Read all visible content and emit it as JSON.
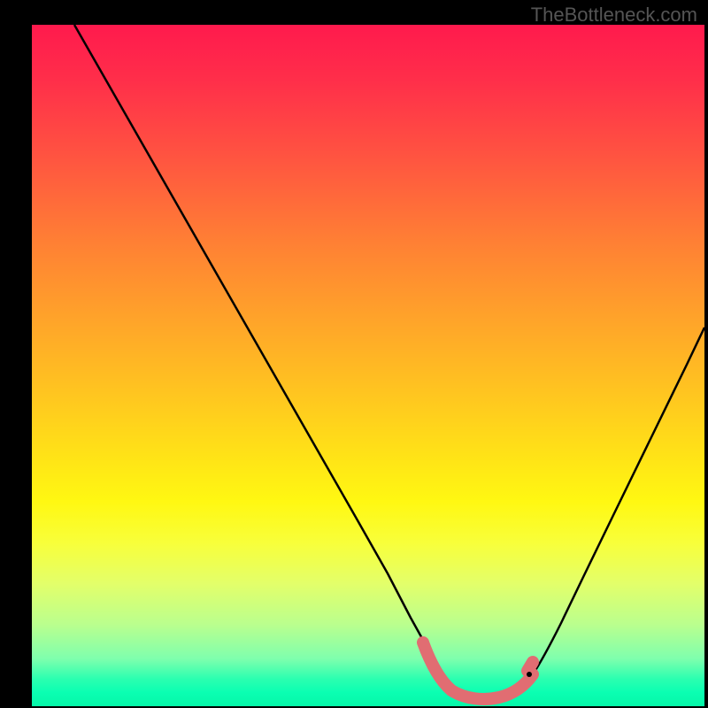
{
  "watermark": "TheBottleneck.com",
  "chart_data": {
    "type": "line",
    "title": "",
    "xlabel": "",
    "ylabel": "",
    "xlim": [
      0,
      100
    ],
    "ylim": [
      0,
      100
    ],
    "series": [
      {
        "name": "bottleneck-curve",
        "x": [
          0,
          5,
          10,
          15,
          20,
          25,
          30,
          35,
          40,
          45,
          50,
          55,
          57,
          59,
          61,
          63,
          65,
          67,
          69,
          71,
          73,
          76,
          80,
          85,
          90,
          95,
          100
        ],
        "y": [
          100,
          92,
          84,
          76,
          68,
          60,
          52,
          44,
          36,
          28,
          20,
          12,
          8,
          5,
          3,
          2,
          1.5,
          1.5,
          2,
          3,
          5,
          9,
          16,
          26,
          37,
          49,
          62
        ]
      }
    ],
    "highlight": {
      "name": "optimal-zone",
      "x": [
        57,
        58,
        59,
        60,
        61,
        62,
        63,
        64,
        65,
        66,
        67,
        68,
        69,
        70,
        71,
        72,
        73
      ],
      "y": [
        8,
        6,
        5,
        4,
        3,
        2.5,
        2,
        1.8,
        1.5,
        1.5,
        1.5,
        2,
        2,
        3,
        3,
        4,
        5
      ]
    },
    "background_gradient": {
      "stops": [
        {
          "pos": 0,
          "color": "#ff1a4d"
        },
        {
          "pos": 20,
          "color": "#ff5640"
        },
        {
          "pos": 44,
          "color": "#ffa629"
        },
        {
          "pos": 64,
          "color": "#ffe516"
        },
        {
          "pos": 82,
          "color": "#e3ff6a"
        },
        {
          "pos": 96,
          "color": "#2bffb0"
        },
        {
          "pos": 100,
          "color": "#06f7a8"
        }
      ]
    }
  }
}
